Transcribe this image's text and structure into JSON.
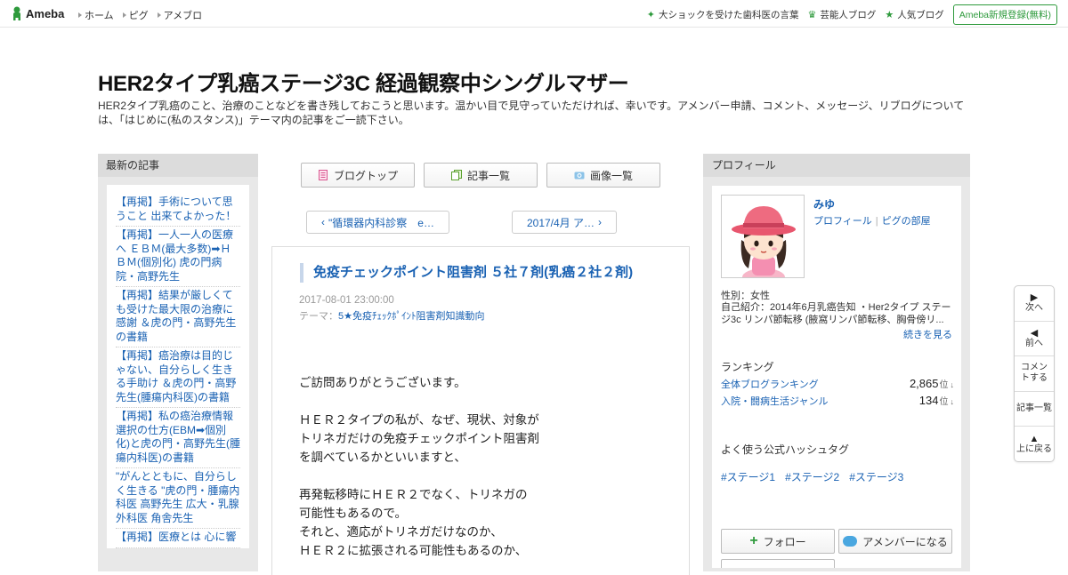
{
  "topbar": {
    "logo_text": "Ameba",
    "nav": [
      "ホーム",
      "ピグ",
      "アメブロ"
    ],
    "right_links": [
      {
        "label": "大ショックを受けた歯科医の言葉",
        "icon": "sparkle-icon"
      },
      {
        "label": "芸能人ブログ",
        "icon": "crown-icon"
      },
      {
        "label": "人気ブログ",
        "icon": "star-icon"
      }
    ],
    "register_label": "Ameba新規登録(無料)"
  },
  "header": {
    "title": "HER2タイプ乳癌ステージ3C 経過観察中シングルマザー",
    "description": "HER2タイプ乳癌のこと、治療のことなどを書き残しておこうと思います。温かい目で見守っていただければ、幸いです。アメンバー申請、コメント、メッセージ、リブログについては、「はじめに(私のスタンス)」テーマ内の記事をご一読下さい。"
  },
  "left": {
    "heading": "最新の記事",
    "items": [
      "【再掲】手術について思うこと 出来てよかった！",
      "【再掲】一人一人の医療へ ＥＢＭ(最大多数)➡ＨＢＭ(個別化) 虎の門病院・高野先生",
      "【再掲】結果が厳しくても受けた最大限の治療に感謝 ＆虎の門・高野先生の書籍",
      "【再掲】癌治療は目的じゃない、自分らしく生きる手助け ＆虎の門・高野先生(腫瘍内科医)の書籍",
      "【再掲】私の癌治療情報選択の仕方(EBM➡個別化)と虎の門・高野先生(腫瘍内科医)の書籍",
      "\"がんとともに、自分らしく生きる \"虎の門・腫瘍内科医 高野先生 広大・乳腺外科医 角舎先生",
      "【再掲】医療とは 心に響"
    ]
  },
  "center": {
    "nav_buttons": [
      {
        "label": "ブログトップ",
        "icon": "document-icon"
      },
      {
        "label": "記事一覧",
        "icon": "list-icon"
      },
      {
        "label": "画像一覧",
        "icon": "camera-icon"
      }
    ],
    "prev_label": "\"循環器内科診察　e…",
    "next_label": "2017/4月 ア…",
    "article": {
      "title": "免疫チェックポイント阻害剤 ５社７剤(乳癌２社２剤)",
      "date": "2017-08-01 23:00:00",
      "theme_prefix": "テーマ：",
      "theme": "5★免疫ﾁｪｯｸﾎﾟｲﾝﾄ阻害剤知識動向",
      "paragraphs": [
        "ご訪問ありがとうございます。",
        "ＨＥＲ２タイプの私が、なぜ、現状、対象が\nトリネガだけの免疫チェックポイント阻害剤\nを調べているかといいますと、",
        "再発転移時にＨＥＲ２でなく、トリネガの\n可能性もあるので。\nそれと、適応がトリネガだけなのか、\nＨＥＲ２に拡張される可能性もあるのか、"
      ]
    }
  },
  "right": {
    "heading": "プロフィール",
    "name": "みゆ",
    "link_profile": "プロフィール",
    "link_pig": "ピグの部屋",
    "gender": "性別：女性",
    "intro": "自己紹介：2014年6月乳癌告知 ・Her2タイプ ステージ3c リンパ節転移 (腋窩リンパ節転移、胸骨傍リ...",
    "more": "続きを見る",
    "ranking_title": "ランキング",
    "rankings": [
      {
        "name": "全体ブログランキング",
        "value": "2,865",
        "unit": "位",
        "arrow": "↓"
      },
      {
        "name": "入院・闘病生活ジャンル",
        "value": "134",
        "unit": "位",
        "arrow": "↓"
      }
    ],
    "hashtag_title": "よく使う公式ハッシュタグ",
    "hashtags": [
      "#ステージ1",
      "#ステージ2",
      "#ステージ3"
    ],
    "follow_label": "フォロー",
    "member_label": "アメンバーになる"
  },
  "sidenav": [
    {
      "glyph": "▶",
      "label": "次へ"
    },
    {
      "glyph": "◀",
      "label": "前へ"
    },
    {
      "glyph": "",
      "label": "コメントする"
    },
    {
      "glyph": "",
      "label": "記事一覧"
    },
    {
      "glyph": "▲",
      "label": "上に戻る"
    }
  ],
  "colors": {
    "accent_green": "#2e9a3c",
    "link_blue": "#1a62b3",
    "sidebar_gray": "#e8e8e8"
  }
}
